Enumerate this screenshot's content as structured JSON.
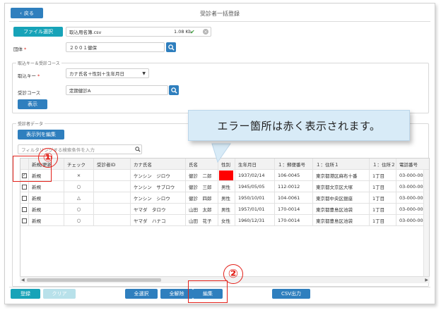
{
  "header": {
    "back_label": "戻る",
    "title": "受診者一括登録"
  },
  "file": {
    "button_label": "ファイル選択",
    "file_name": "取込用名簿.csv",
    "file_size": "1.08 Kb"
  },
  "group": {
    "label": "団体",
    "value": "２００１健保"
  },
  "import_panel": {
    "legend": "取込キー＆受診コース",
    "key_label": "取込キー",
    "key_value": "カナ氏名＋性別＋生年月日",
    "course_label": "受診コース",
    "course_value": "定期健診A",
    "show_label": "表示"
  },
  "data_panel": {
    "legend": "受診者データ",
    "edit_columns_label": "表示列を編集",
    "filter_placeholder": "フィルタリングする検索条件を入力"
  },
  "table": {
    "columns": [
      "",
      "新規/更新",
      "チェック",
      "受診者ID",
      "カナ氏名",
      "氏名",
      "性別",
      "生年月日",
      "１：郵便番号",
      "１：住所１",
      "１：住所２",
      "電話番号"
    ],
    "rows": [
      {
        "checked": true,
        "status": "新規",
        "check": "×",
        "id": "",
        "kana": "ケンシン　ジロウ",
        "name": "健診　二郎",
        "sex": "",
        "dob": "1937/02/14",
        "zip": "106-0045",
        "addr1": "東京都港区麻布十番",
        "addr2": "1丁目",
        "tel": "03-000-0000"
      },
      {
        "checked": false,
        "status": "新規",
        "check": "○",
        "id": "",
        "kana": "ケンシン　サブロウ",
        "name": "健診　三郎",
        "sex": "男性",
        "dob": "1945/05/05",
        "zip": "112-0012",
        "addr1": "東京都文京区大塚",
        "addr2": "1丁目",
        "tel": "03-000-0001"
      },
      {
        "checked": false,
        "status": "新規",
        "check": "△",
        "id": "",
        "kana": "ケンシン　シロウ",
        "name": "健診　四郎",
        "sex": "男性",
        "dob": "1950/10/01",
        "zip": "104-0061",
        "addr1": "東京都中央区銀座",
        "addr2": "1丁目",
        "tel": "03-000-0003"
      },
      {
        "checked": false,
        "status": "新規",
        "check": "○",
        "id": "",
        "kana": "ヤマダ　タロウ",
        "name": "山田　太郎",
        "sex": "男性",
        "dob": "1957/01/01",
        "zip": "170-0014",
        "addr1": "東京都豊島区池袋",
        "addr2": "1丁目",
        "tel": "03-000-0003"
      },
      {
        "checked": false,
        "status": "新規",
        "check": "○",
        "id": "",
        "kana": "ヤマダ　ハナコ",
        "name": "山田　花子",
        "sex": "女性",
        "dob": "1960/12/31",
        "zip": "170-0014",
        "addr1": "東京都豊島区池袋",
        "addr2": "1丁目",
        "tel": "03-000-0003"
      }
    ]
  },
  "footer": {
    "register_label": "登録",
    "clear_label": "クリア",
    "select_all_label": "全選択",
    "deselect_all_label": "全解除",
    "edit_label": "編集",
    "csv_label": "CSV出力"
  },
  "annotations": {
    "callout_text": "エラー箇所は赤く表示されます。",
    "marker_1": "①",
    "marker_2": "②"
  },
  "colors": {
    "primary": "#2f7fbe",
    "teal": "#17a3b8",
    "error": "#ff0000",
    "annotation": "#e3211a",
    "callout_bg": "#d8ebf7"
  },
  "icons": [
    "chevron-left-icon",
    "check-icon",
    "clear-icon",
    "search-icon",
    "dropdown-arrow-icon"
  ]
}
